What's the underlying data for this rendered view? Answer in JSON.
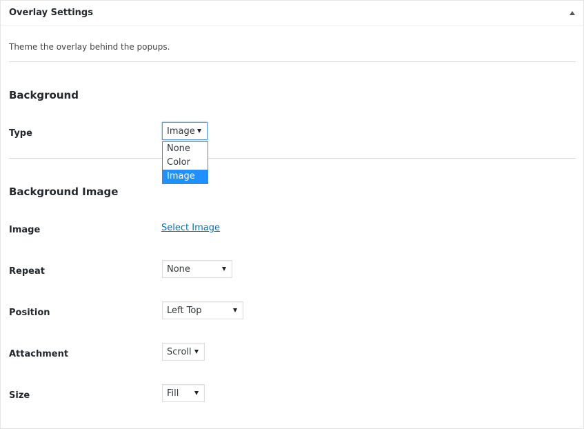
{
  "panel": {
    "title": "Overlay Settings",
    "description": "Theme the overlay behind the popups.",
    "toggle_icon": "triangle-up-icon"
  },
  "background": {
    "section_title": "Background",
    "type": {
      "label": "Type",
      "value": "Image",
      "options": [
        "None",
        "Color",
        "Image"
      ],
      "selected_index": 2
    }
  },
  "background_image": {
    "section_title": "Background Image",
    "image": {
      "label": "Image",
      "link_text": "Select Image"
    },
    "repeat": {
      "label": "Repeat",
      "value": "None"
    },
    "position": {
      "label": "Position",
      "value": "Left Top"
    },
    "attachment": {
      "label": "Attachment",
      "value": "Scroll"
    },
    "size": {
      "label": "Size",
      "value": "Fill"
    }
  },
  "colors": {
    "link": "#0073aa",
    "highlight": "#1e90ff",
    "focus_border": "#5b9dd9"
  }
}
